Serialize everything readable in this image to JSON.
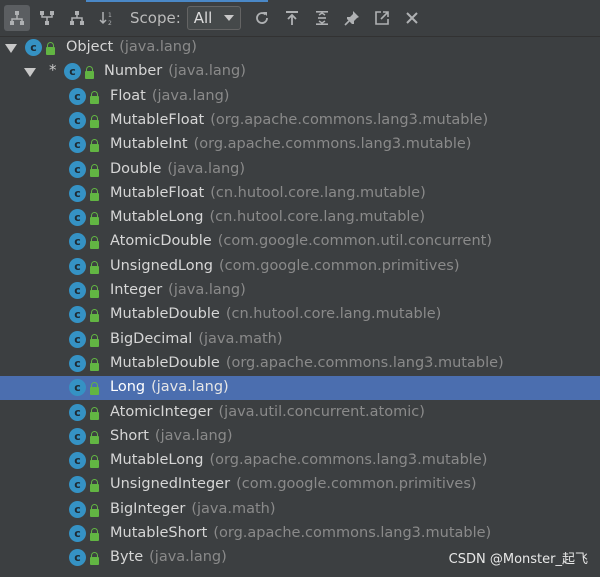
{
  "toolbar": {
    "scope_label": "Scope:",
    "scope_value": "All",
    "buttons": [
      {
        "icon": "type-hierarchy-icon",
        "pressed": true
      },
      {
        "icon": "supertypes-icon",
        "pressed": false
      },
      {
        "icon": "subtypes-icon",
        "pressed": false
      },
      {
        "icon": "sort-alphabetically-icon",
        "pressed": false
      },
      {
        "icon": "refresh-icon",
        "pressed": false
      },
      {
        "icon": "export-icon",
        "pressed": false
      },
      {
        "icon": "expand-all-icon",
        "pressed": false
      },
      {
        "icon": "pin-icon",
        "pressed": false
      },
      {
        "icon": "open-in-window-icon",
        "pressed": false
      },
      {
        "icon": "close-icon",
        "pressed": false
      }
    ]
  },
  "tree": {
    "rows": [
      {
        "name": "Object",
        "pkg": "(java.lang)",
        "level": 0,
        "expanded": true,
        "star": false,
        "selected": false
      },
      {
        "name": "Number",
        "pkg": "(java.lang)",
        "level": 1,
        "expanded": true,
        "star": true,
        "selected": false
      },
      {
        "name": "Float",
        "pkg": "(java.lang)",
        "level": 2,
        "selected": false
      },
      {
        "name": "MutableFloat",
        "pkg": "(org.apache.commons.lang3.mutable)",
        "level": 2,
        "selected": false
      },
      {
        "name": "MutableInt",
        "pkg": "(org.apache.commons.lang3.mutable)",
        "level": 2,
        "selected": false
      },
      {
        "name": "Double",
        "pkg": "(java.lang)",
        "level": 2,
        "selected": false
      },
      {
        "name": "MutableFloat",
        "pkg": "(cn.hutool.core.lang.mutable)",
        "level": 2,
        "selected": false
      },
      {
        "name": "MutableLong",
        "pkg": "(cn.hutool.core.lang.mutable)",
        "level": 2,
        "selected": false
      },
      {
        "name": "AtomicDouble",
        "pkg": "(com.google.common.util.concurrent)",
        "level": 2,
        "selected": false
      },
      {
        "name": "UnsignedLong",
        "pkg": "(com.google.common.primitives)",
        "level": 2,
        "selected": false
      },
      {
        "name": "Integer",
        "pkg": "(java.lang)",
        "level": 2,
        "selected": false
      },
      {
        "name": "MutableDouble",
        "pkg": "(cn.hutool.core.lang.mutable)",
        "level": 2,
        "selected": false
      },
      {
        "name": "BigDecimal",
        "pkg": "(java.math)",
        "level": 2,
        "selected": false
      },
      {
        "name": "MutableDouble",
        "pkg": "(org.apache.commons.lang3.mutable)",
        "level": 2,
        "selected": false
      },
      {
        "name": "Long",
        "pkg": "(java.lang)",
        "level": 2,
        "selected": true
      },
      {
        "name": "AtomicInteger",
        "pkg": "(java.util.concurrent.atomic)",
        "level": 2,
        "selected": false
      },
      {
        "name": "Short",
        "pkg": "(java.lang)",
        "level": 2,
        "selected": false
      },
      {
        "name": "MutableLong",
        "pkg": "(org.apache.commons.lang3.mutable)",
        "level": 2,
        "selected": false
      },
      {
        "name": "UnsignedInteger",
        "pkg": "(com.google.common.primitives)",
        "level": 2,
        "selected": false
      },
      {
        "name": "BigInteger",
        "pkg": "(java.math)",
        "level": 2,
        "selected": false
      },
      {
        "name": "MutableShort",
        "pkg": "(org.apache.commons.lang3.mutable)",
        "level": 2,
        "selected": false
      },
      {
        "name": "Byte",
        "pkg": "(java.lang)",
        "level": 2,
        "selected": false
      }
    ]
  },
  "watermark": "CSDN @Monster_起飞",
  "colors": {
    "selection": "#4b6eaf",
    "class_icon": "#3592c4",
    "access_public": "#62b543",
    "background": "#3c3f41"
  }
}
